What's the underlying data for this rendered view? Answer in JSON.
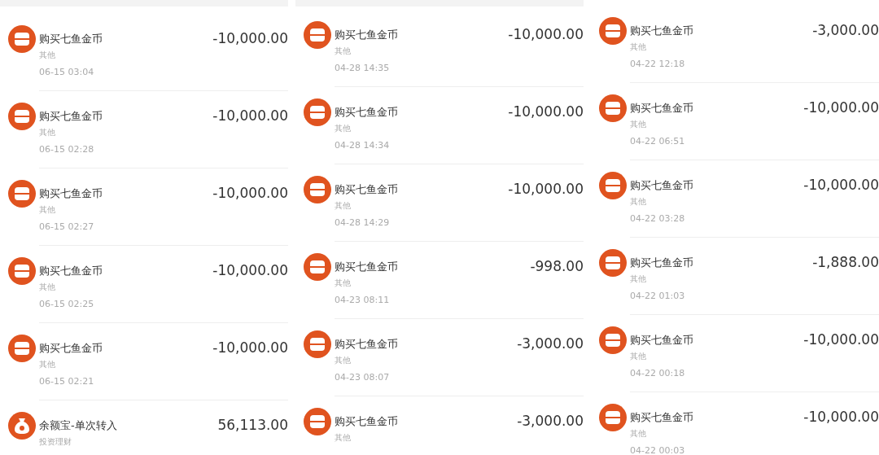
{
  "panels": [
    {
      "transactions": [
        {
          "kind": "shop",
          "title": "购买七鱼金币",
          "category": "其他",
          "time": "06-15 03:04",
          "amount": "-10,000.00"
        },
        {
          "kind": "shop",
          "title": "购买七鱼金币",
          "category": "其他",
          "time": "06-15 02:28",
          "amount": "-10,000.00"
        },
        {
          "kind": "shop",
          "title": "购买七鱼金币",
          "category": "其他",
          "time": "06-15 02:27",
          "amount": "-10,000.00"
        },
        {
          "kind": "shop",
          "title": "购买七鱼金币",
          "category": "其他",
          "time": "06-15 02:25",
          "amount": "-10,000.00"
        },
        {
          "kind": "shop",
          "title": "购买七鱼金币",
          "category": "其他",
          "time": "06-15 02:21",
          "amount": "-10,000.00"
        },
        {
          "kind": "moneybag",
          "title": "余额宝-单次转入",
          "category": "投资理财",
          "amount": "56,113.00"
        }
      ]
    },
    {
      "transactions": [
        {
          "kind": "shop",
          "title": "购买七鱼金币",
          "category": "其他",
          "time": "04-28 14:35",
          "amount": "-10,000.00"
        },
        {
          "kind": "shop",
          "title": "购买七鱼金币",
          "category": "其他",
          "time": "04-28 14:34",
          "amount": "-10,000.00"
        },
        {
          "kind": "shop",
          "title": "购买七鱼金币",
          "category": "其他",
          "time": "04-28 14:29",
          "amount": "-10,000.00"
        },
        {
          "kind": "shop",
          "title": "购买七鱼金币",
          "category": "其他",
          "time": "04-23 08:11",
          "amount": "-998.00"
        },
        {
          "kind": "shop",
          "title": "购买七鱼金币",
          "category": "其他",
          "time": "04-23 08:07",
          "amount": "-3,000.00"
        },
        {
          "kind": "shop",
          "title": "购买七鱼金币",
          "category": "其他",
          "amount": "-3,000.00"
        }
      ]
    },
    {
      "transactions": [
        {
          "kind": "shop",
          "title": "购买七鱼金币",
          "category": "其他",
          "time": "04-22 12:18",
          "amount": "-3,000.00"
        },
        {
          "kind": "shop",
          "title": "购买七鱼金币",
          "category": "其他",
          "time": "04-22 06:51",
          "amount": "-10,000.00"
        },
        {
          "kind": "shop",
          "title": "购买七鱼金币",
          "category": "其他",
          "time": "04-22 03:28",
          "amount": "-10,000.00"
        },
        {
          "kind": "shop",
          "title": "购买七鱼金币",
          "category": "其他",
          "time": "04-22 01:03",
          "amount": "-1,888.00"
        },
        {
          "kind": "shop",
          "title": "购买七鱼金币",
          "category": "其他",
          "time": "04-22 00:18",
          "amount": "-10,000.00"
        },
        {
          "kind": "shop",
          "title": "购买七鱼金币",
          "category": "其他",
          "time": "04-22 00:03",
          "amount": "-10,000.00"
        }
      ]
    }
  ]
}
